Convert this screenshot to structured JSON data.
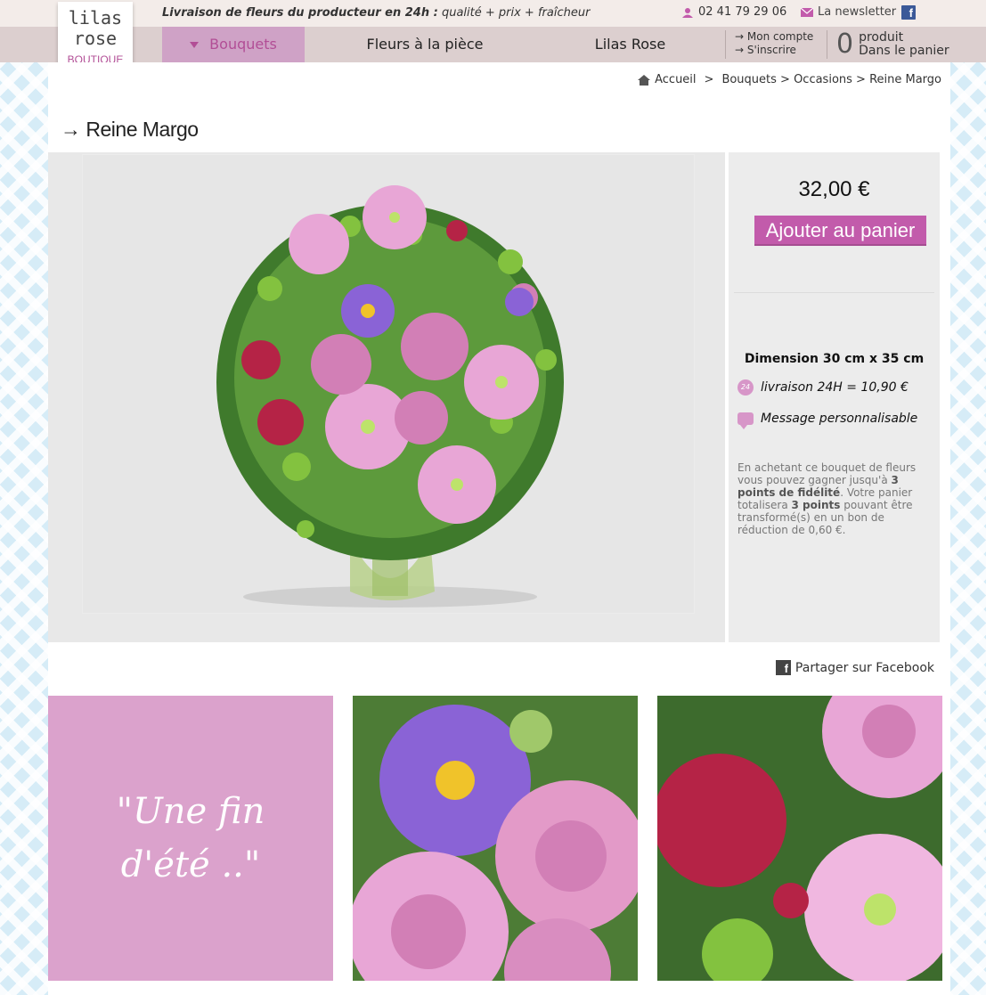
{
  "logo": {
    "line1": "lilas",
    "line2": "rose",
    "line3": "BOUTIQUE"
  },
  "topbar": {
    "tagline_bold": "Livraison de fleurs du producteur en 24h :",
    "tagline_rest": "qualité + prix + fraîcheur",
    "phone": "02 41 79 29 06",
    "newsletter": "La newsletter",
    "facebook_glyph": "f"
  },
  "nav": {
    "items": [
      {
        "label": "Bouquets",
        "active": true
      },
      {
        "label": "Fleurs à la pièce",
        "active": false
      },
      {
        "label": "Lilas Rose",
        "active": false
      }
    ],
    "account": {
      "my_account": "→ Mon compte",
      "register": "→ S'inscrire"
    },
    "cart": {
      "count": "0",
      "line1": "produit",
      "line2": "Dans le panier"
    }
  },
  "breadcrumb": {
    "home": "Accueil",
    "sep": ">",
    "path": "Bouquets > Occasions > Reine Margo"
  },
  "product": {
    "title": "→ Reine Margo",
    "price": "32,00 €",
    "add_to_cart": "Ajouter au panier",
    "dimension": "Dimension 30 cm x 35 cm",
    "timer_glyph": "24",
    "delivery": "livraison 24H = 10,90 €",
    "message": "Message personnalisable",
    "loyalty": {
      "p1": "En achetant ce bouquet de fleurs vous pouvez gagner jusqu'à ",
      "b1": "3 points de fidélité",
      "p2": ". Votre panier totalisera ",
      "b2": "3 points",
      "p3": " pouvant être transformé(s) en un bon de réduction de 0,60 €."
    }
  },
  "share": {
    "glyph": "f",
    "label": "Partager sur Facebook"
  },
  "quote": {
    "line1": "\"Une fin",
    "line2": "d'été ..\""
  },
  "colors": {
    "accent": "#c25bab",
    "nav_bg": "#dccfcf",
    "quote_bg": "#dba2cc"
  }
}
